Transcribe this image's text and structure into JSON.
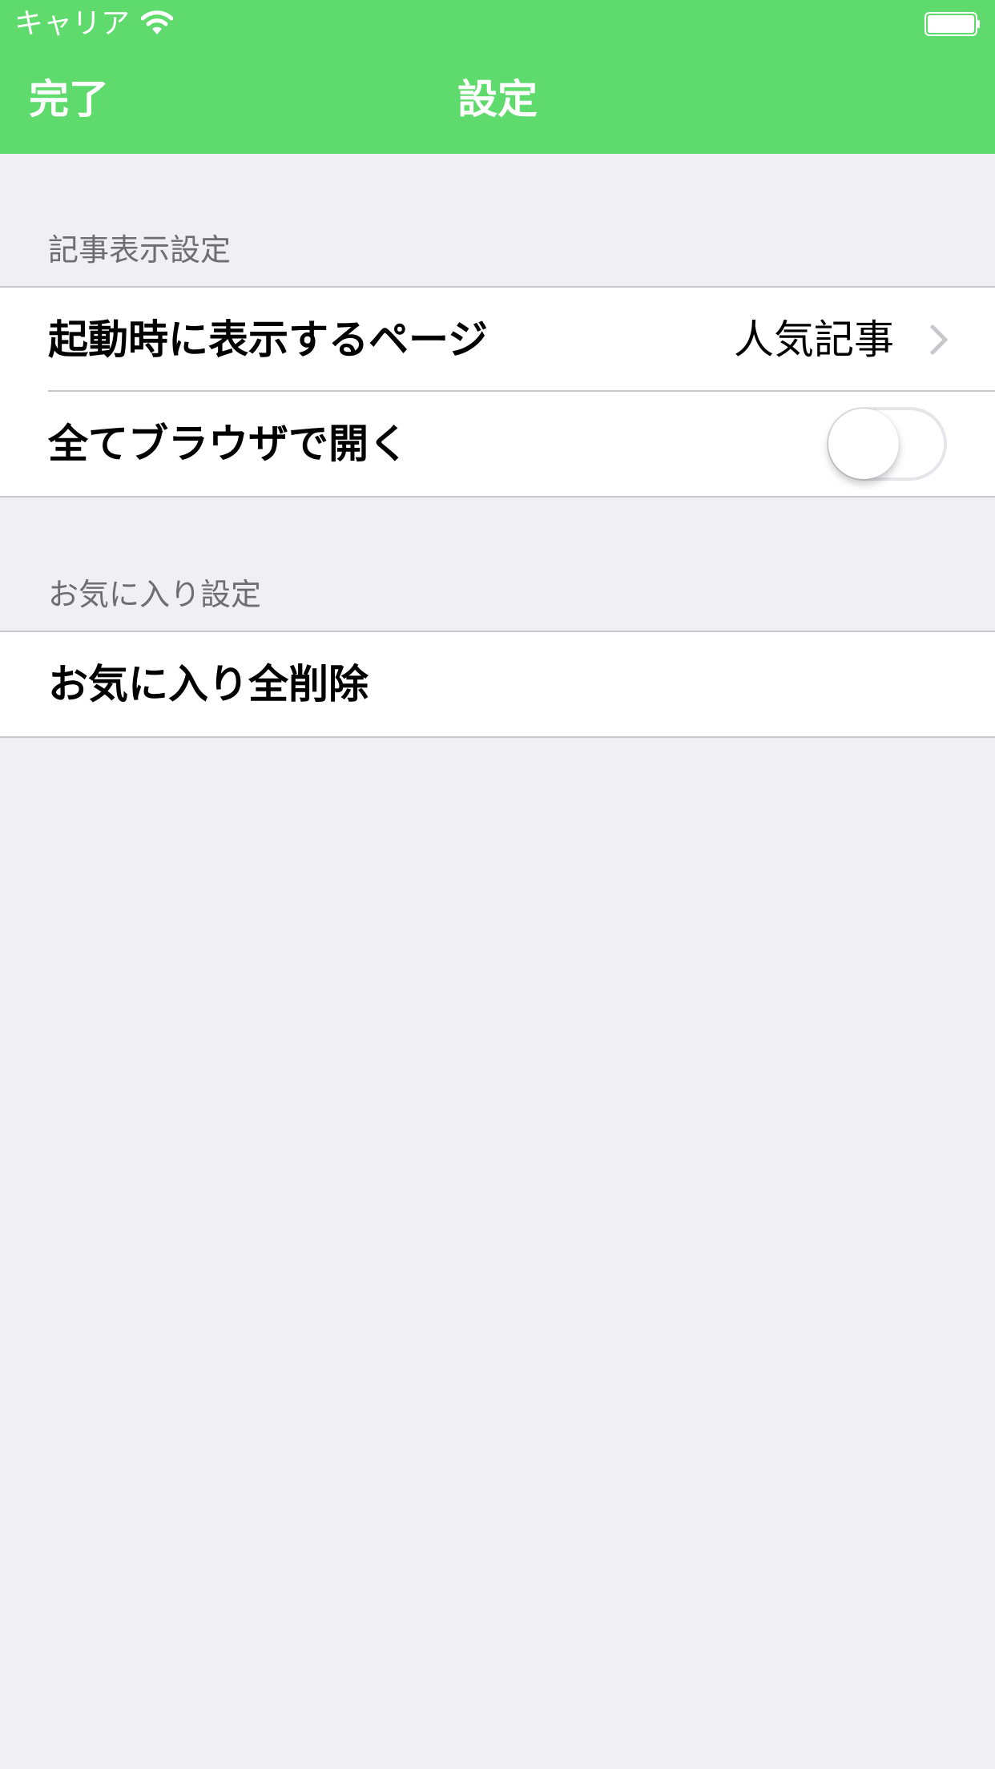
{
  "status_bar": {
    "carrier": "キャリア",
    "wifi_icon": "wifi-icon",
    "battery_icon": "battery-icon"
  },
  "nav": {
    "done_label": "完了",
    "title": "設定"
  },
  "sections": [
    {
      "header": "記事表示設定",
      "rows": [
        {
          "label": "起動時に表示するページ",
          "value": "人気記事",
          "accessory": "chevron-right-icon"
        },
        {
          "label": "全てブラウザで開く",
          "accessory": "toggle",
          "toggle_on": false
        }
      ]
    },
    {
      "header": "お気に入り設定",
      "rows": [
        {
          "label": "お気に入り全削除"
        }
      ]
    }
  ],
  "colors": {
    "accent": "#5fdb6d",
    "background": "#efeff4",
    "cell_background": "#ffffff",
    "separator": "#c8c7cc",
    "section_header_text": "#6d6d72",
    "chevron": "#c7c7cc"
  }
}
